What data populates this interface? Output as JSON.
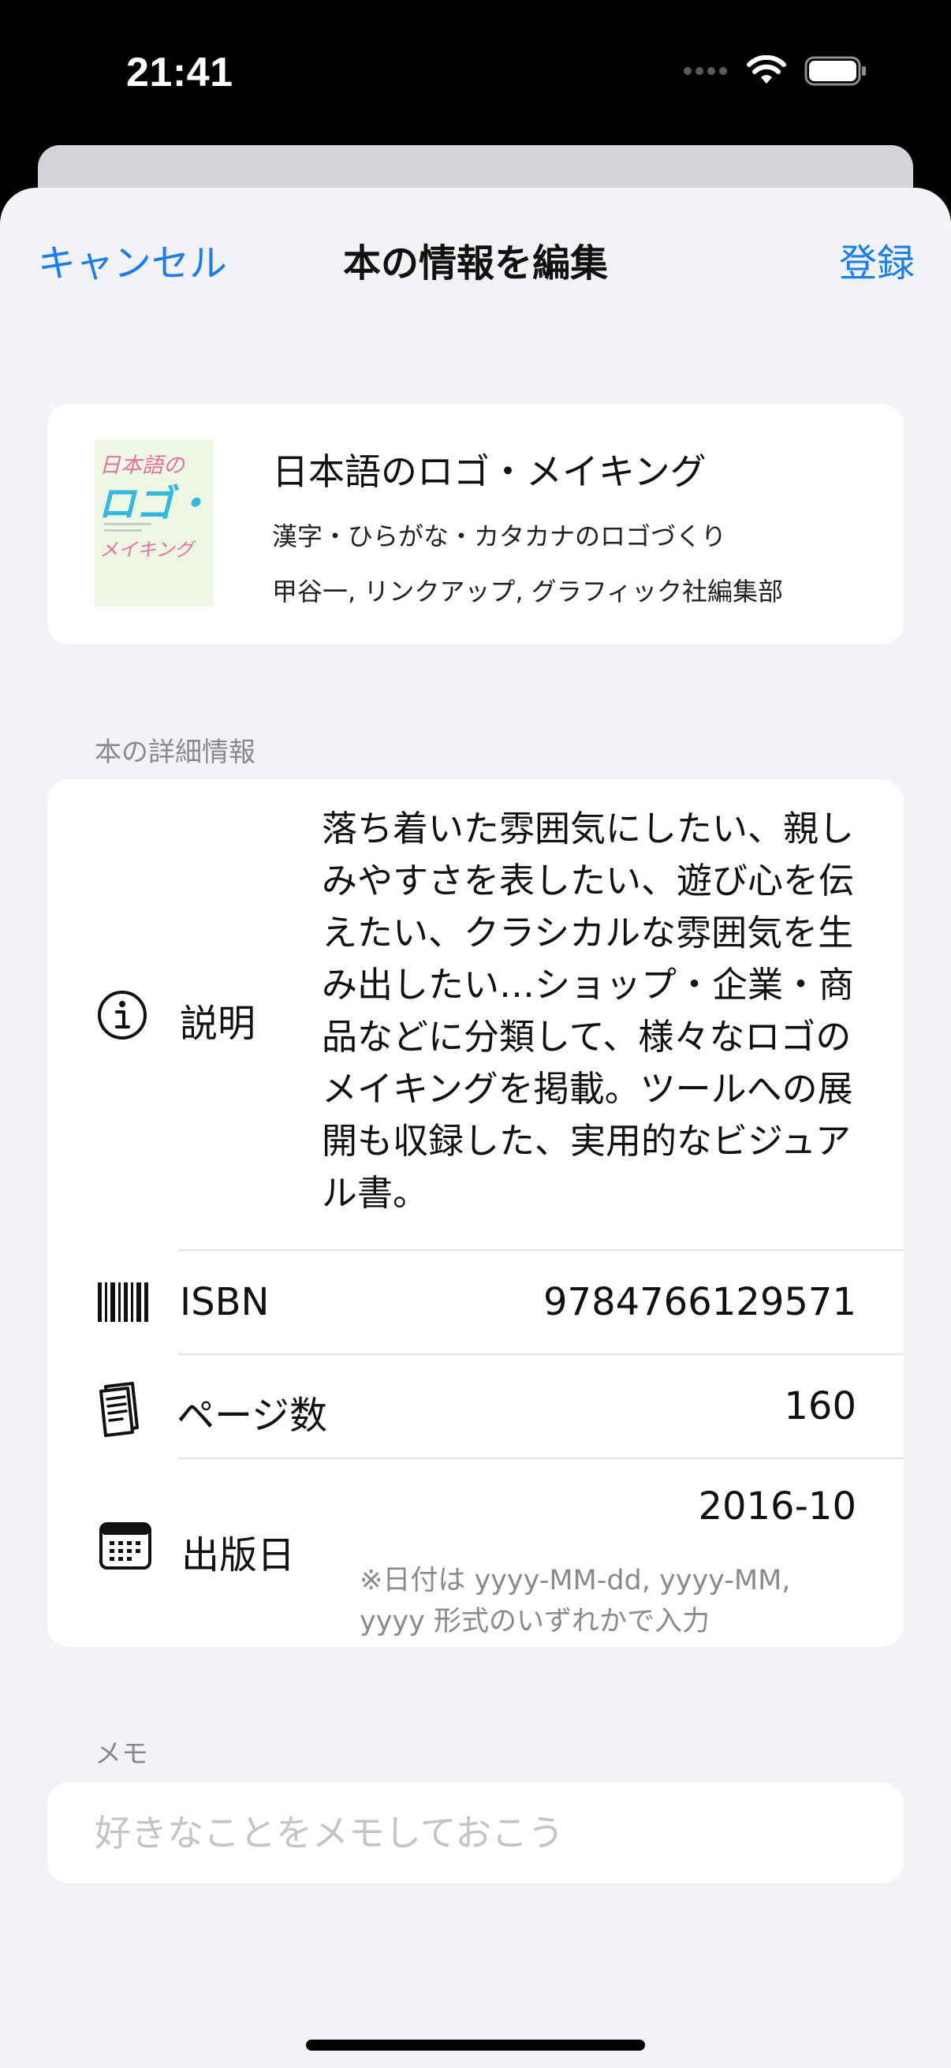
{
  "status_bar": {
    "time": "21:41"
  },
  "nav": {
    "cancel_label": "キャンセル",
    "title": "本の情報を編集",
    "register_label": "登録"
  },
  "book": {
    "cover_text_line1": "日本語の",
    "cover_text_line2": "ロゴ・",
    "cover_text_line3": "メイキング",
    "title": "日本語のロゴ・メイキング",
    "subtitle": "漢字・ひらがな・カタカナのロゴづくり",
    "authors": "甲谷一, リンクアップ, グラフィック社編集部"
  },
  "details": {
    "header": "本の詳細情報",
    "description": {
      "label": "説明",
      "value": "落ち着いた雰囲気にしたい、親しみやすさを表したい、遊び心を伝えたい、クラシカルな雰囲気を生み出したい…ショップ・企業・商品などに分類して、様々なロゴのメイキングを掲載。ツールへの展開も収録した、実用的なビジュアル書。"
    },
    "isbn": {
      "label": "ISBN",
      "value": "9784766129571"
    },
    "pages": {
      "label": "ページ数",
      "value": "160"
    },
    "published": {
      "label": "出版日",
      "value": "2016-10",
      "hint": "※日付は yyyy-MM-dd, yyyy-MM, yyyy 形式のいずれかで入力"
    }
  },
  "memo": {
    "header": "メモ",
    "placeholder": "好きなことをメモしておこう"
  },
  "colors": {
    "accent": "#1a7ef0",
    "background": "#f2f2f7",
    "card": "#ffffff",
    "secondary_text": "#8a8a8e"
  },
  "icons": [
    "wifi-icon",
    "battery-icon",
    "info-icon",
    "barcode-icon",
    "pages-icon",
    "calendar-icon"
  ]
}
